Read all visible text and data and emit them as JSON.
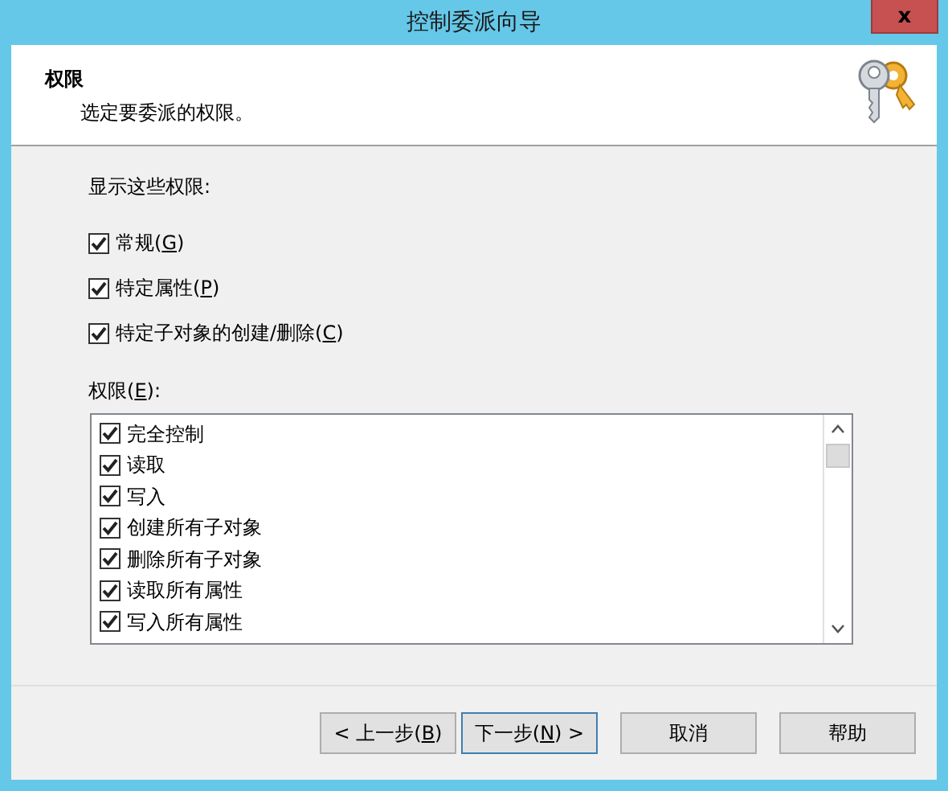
{
  "window": {
    "title": "控制委派向导",
    "close": "x"
  },
  "header": {
    "title": "权限",
    "subtitle": "选定要委派的权限。"
  },
  "show_label": "显示这些权限:",
  "filters": [
    {
      "pre": "常规(",
      "key": "G",
      "post": ")",
      "checked": true
    },
    {
      "pre": "特定属性(",
      "key": "P",
      "post": ")",
      "checked": true
    },
    {
      "pre": "特定子对象的创建/删除(",
      "key": "C",
      "post": ")",
      "checked": true
    }
  ],
  "list_label": {
    "pre": "权限(",
    "key": "E",
    "post": "):"
  },
  "permissions": [
    {
      "label": "完全控制",
      "checked": true
    },
    {
      "label": "读取",
      "checked": true
    },
    {
      "label": "写入",
      "checked": true
    },
    {
      "label": "创建所有子对象",
      "checked": true
    },
    {
      "label": "删除所有子对象",
      "checked": true
    },
    {
      "label": "读取所有属性",
      "checked": true
    },
    {
      "label": "写入所有属性",
      "checked": true
    }
  ],
  "buttons": [
    {
      "lead": "< ",
      "pre": "上一步(",
      "key": "B",
      "post": ")",
      "default": false
    },
    {
      "pre": "下一步(",
      "key": "N",
      "post": ")",
      "trail": " >",
      "default": true
    },
    {
      "pre": "取消",
      "default": false
    },
    {
      "pre": "帮助",
      "default": false
    }
  ]
}
